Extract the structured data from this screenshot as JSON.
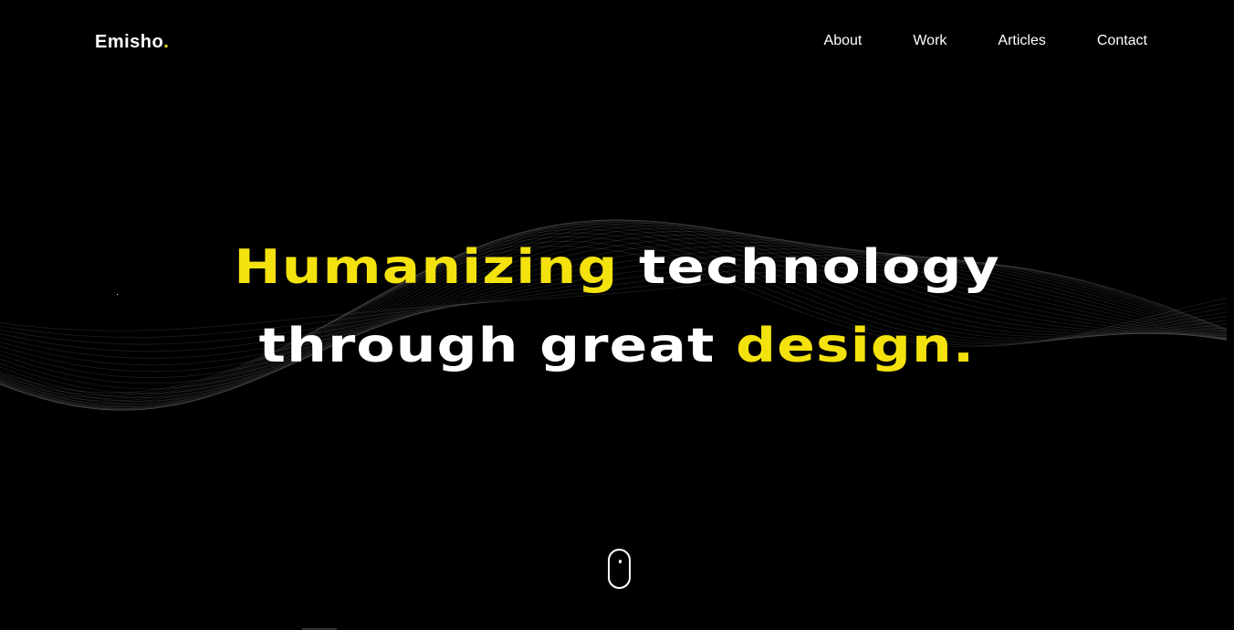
{
  "brand": {
    "name": "Emisho",
    "dot": "."
  },
  "nav": {
    "items": [
      {
        "label": "About"
      },
      {
        "label": "Work"
      },
      {
        "label": "Articles"
      },
      {
        "label": "Contact"
      }
    ]
  },
  "hero": {
    "line1_highlight": "Humanizing",
    "line1_rest": " technology",
    "line2_start": "through great ",
    "line2_highlight": "design."
  },
  "icons": {
    "scroll": "mouse-scroll-icon"
  },
  "colors": {
    "background": "#000000",
    "accent": "#f4e20e",
    "text": "#ffffff"
  }
}
